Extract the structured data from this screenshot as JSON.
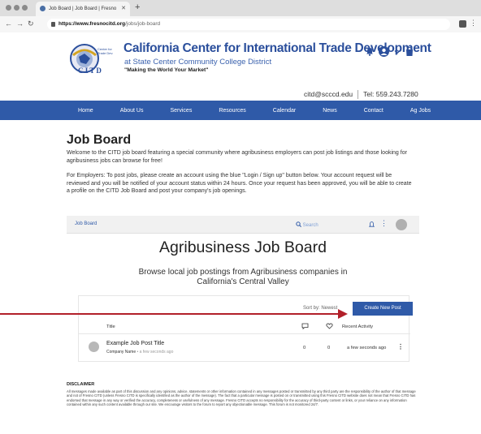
{
  "browser": {
    "tab_title": "Job Board | Job Board | Fresno",
    "url_host": "https://www.fresnocitd.org",
    "url_path": "/jobs/job-board"
  },
  "site": {
    "title": "California Center for International Trade Development",
    "subtitle": "at State Center Community College District",
    "tagline": "\"Making the World Your Market\"",
    "email": "citd@scccd.edu",
    "phone": "Tel: 559.243.7280"
  },
  "nav": [
    "Home",
    "About Us",
    "Services",
    "Resources",
    "Calendar",
    "News",
    "Contact",
    "Ag Jobs"
  ],
  "page": {
    "heading": "Job Board",
    "intro": "Welcome to the CITD job board featuring a special community where agribusiness employers can post job listings and those looking for agribusiness jobs can browse for free!",
    "employers": "For Employers: To post jobs, please create an account using the blue \"Login / Sign up\" button below. Your account request will be reviewed and you will be notified of your account status within 24 hours. Once your request has been approved, you will be able to create a profile on the CITD Job Board and post your company's job openings."
  },
  "forum": {
    "breadcrumb": "Job Board",
    "search_placeholder": "Search",
    "title": "Agribusiness Job Board",
    "subtitle": "Browse local job postings from Agribusiness companies in California's Central Valley",
    "sort_label": "Sort by: Newest",
    "new_post_label": "Create New Post",
    "columns": {
      "title": "Title",
      "activity": "Recent Activity"
    },
    "posts": [
      {
        "title": "Example Job Post Title",
        "company": "Company Name",
        "age": "a few seconds ago",
        "comments": "0",
        "likes": "0",
        "activity": "a few seconds ago"
      }
    ]
  },
  "disclaimer": {
    "heading": "DISCLAIMER",
    "text": "All messages made available as part of this discussion and any opinions, advice, statements or other information contained in any messages posted or transmitted by any third party are the responsibility of the author of that message and not of Fresno CITD (unless Fresno CITD is specifically identified as the author of the message). The fact that a particular message is posted on or transmitted using this Fresno CITD website does not mean that Fresno CITD has endorsed that message in any way or verified the accuracy, completeness or usefulness of any message. Fresno CITD accepts no responsibility for the accuracy of third-party content or links, or your reliance on any information contained within any such content available through our site. We encourage visitors to the forum to report any objectionable message. This forum is not monitored 24/7."
  },
  "colors": {
    "brand_blue": "#2f5aa8",
    "arrow_red": "#b2202a"
  },
  "icons": [
    "bell-icon",
    "account-icon",
    "cart-icon",
    "search-icon",
    "notification-icon",
    "comment-icon",
    "heart-icon",
    "more-icon"
  ]
}
